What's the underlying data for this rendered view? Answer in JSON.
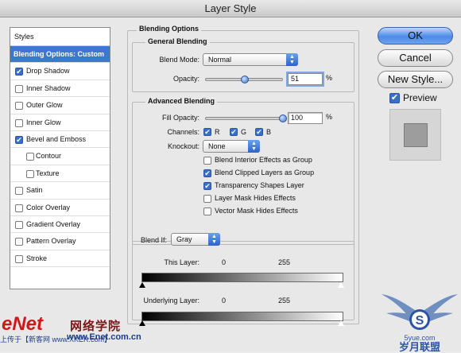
{
  "window": {
    "title": "Layer Style"
  },
  "styles_panel": {
    "header": "Styles",
    "items": [
      {
        "label": "Blending Options: Custom",
        "selected": true,
        "checkbox": false,
        "checked": false,
        "sub": false
      },
      {
        "label": "Drop Shadow",
        "selected": false,
        "checkbox": true,
        "checked": true,
        "sub": false
      },
      {
        "label": "Inner Shadow",
        "selected": false,
        "checkbox": true,
        "checked": false,
        "sub": false
      },
      {
        "label": "Outer Glow",
        "selected": false,
        "checkbox": true,
        "checked": false,
        "sub": false
      },
      {
        "label": "Inner Glow",
        "selected": false,
        "checkbox": true,
        "checked": false,
        "sub": false
      },
      {
        "label": "Bevel and Emboss",
        "selected": false,
        "checkbox": true,
        "checked": true,
        "sub": false
      },
      {
        "label": "Contour",
        "selected": false,
        "checkbox": true,
        "checked": false,
        "sub": true
      },
      {
        "label": "Texture",
        "selected": false,
        "checkbox": true,
        "checked": false,
        "sub": true
      },
      {
        "label": "Satin",
        "selected": false,
        "checkbox": true,
        "checked": false,
        "sub": false
      },
      {
        "label": "Color Overlay",
        "selected": false,
        "checkbox": true,
        "checked": false,
        "sub": false
      },
      {
        "label": "Gradient Overlay",
        "selected": false,
        "checkbox": true,
        "checked": false,
        "sub": false
      },
      {
        "label": "Pattern Overlay",
        "selected": false,
        "checkbox": true,
        "checked": false,
        "sub": false
      },
      {
        "label": "Stroke",
        "selected": false,
        "checkbox": true,
        "checked": false,
        "sub": false
      }
    ]
  },
  "blending_options": {
    "title": "Blending Options",
    "general": {
      "title": "General Blending",
      "blend_mode_label": "Blend Mode:",
      "blend_mode_value": "Normal",
      "opacity_label": "Opacity:",
      "opacity_value": "51",
      "opacity_percent": 51,
      "percent_sign": "%"
    },
    "advanced": {
      "title": "Advanced Blending",
      "fill_opacity_label": "Fill Opacity:",
      "fill_opacity_value": "100",
      "fill_opacity_percent": 100,
      "percent_sign": "%",
      "channels_label": "Channels:",
      "channels": [
        {
          "label": "R",
          "checked": true
        },
        {
          "label": "G",
          "checked": true
        },
        {
          "label": "B",
          "checked": true
        }
      ],
      "knockout_label": "Knockout:",
      "knockout_value": "None",
      "options": [
        {
          "label": "Blend Interior Effects as Group",
          "checked": false
        },
        {
          "label": "Blend Clipped Layers as Group",
          "checked": true
        },
        {
          "label": "Transparency Shapes Layer",
          "checked": true
        },
        {
          "label": "Layer Mask Hides Effects",
          "checked": false
        },
        {
          "label": "Vector Mask Hides Effects",
          "checked": false
        }
      ]
    },
    "blend_if": {
      "label": "Blend If:",
      "value": "Gray",
      "this_layer_label": "This Layer:",
      "this_layer_min": "0",
      "this_layer_max": "255",
      "underlying_label": "Underlying Layer:",
      "underlying_min": "0",
      "underlying_max": "255"
    }
  },
  "buttons": {
    "ok": "OK",
    "cancel": "Cancel",
    "new_style": "New Style...",
    "preview_label": "Preview",
    "preview_checked": true
  },
  "watermark": {
    "logo": "eNet",
    "site_name": "网络学院",
    "url": "www.Enet.com.cn",
    "upload_text": "上传于【新客网 www.XKER.com】",
    "emblem_text": "岁月联盟",
    "emblem_url": "5yue.com",
    "emblem_letter": "S"
  },
  "colors": {
    "accent": "#3c78d0",
    "watermark_red": "#d01818",
    "watermark_blue": "#1d3c8c"
  }
}
